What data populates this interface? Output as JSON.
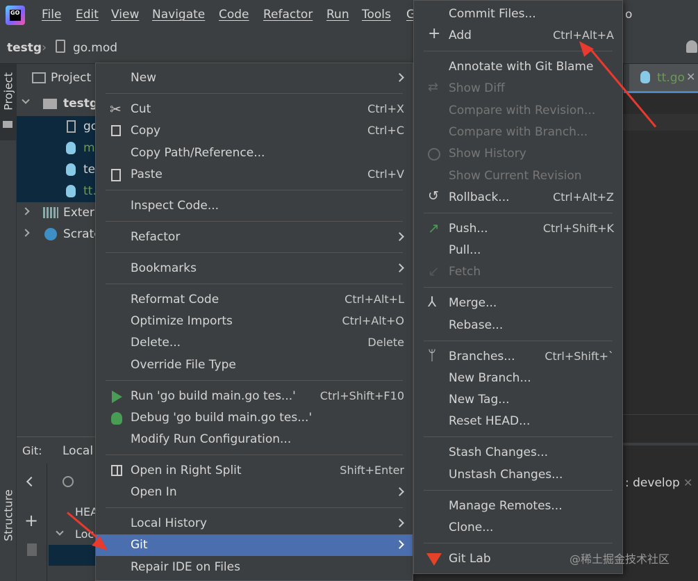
{
  "menubar": {
    "items": [
      "File",
      "Edit",
      "View",
      "Navigate",
      "Code",
      "Refactor",
      "Run",
      "Tools",
      "G"
    ],
    "logo_text": "GO",
    "trailing_text": "o"
  },
  "breadcrumb": {
    "project": "testg",
    "file": "go.mod"
  },
  "left_strip": {
    "project_tab": "Project",
    "structure_tab": "Structure"
  },
  "project_panel": {
    "header": "Project",
    "root": "testg",
    "files": [
      "go",
      "m",
      "te",
      "tt."
    ],
    "external": "Extern",
    "scratches": "Scratc"
  },
  "git_panel": {
    "label": "Git:",
    "local_tab": "Local",
    "head": "HEA",
    "local": "Loc"
  },
  "editor": {
    "tab": "tt.go",
    "branch_text": ": develop"
  },
  "context_menu": {
    "items": [
      {
        "label": "New",
        "shortcut": "",
        "submenu": true
      },
      {
        "label": "Cut",
        "shortcut": "Ctrl+X"
      },
      {
        "label": "Copy",
        "shortcut": "Ctrl+C"
      },
      {
        "label": "Copy Path/Reference...",
        "shortcut": ""
      },
      {
        "label": "Paste",
        "shortcut": "Ctrl+V"
      },
      {
        "label": "Inspect Code...",
        "shortcut": ""
      },
      {
        "label": "Refactor",
        "shortcut": "",
        "submenu": true
      },
      {
        "label": "Bookmarks",
        "shortcut": "",
        "submenu": true
      },
      {
        "label": "Reformat Code",
        "shortcut": "Ctrl+Alt+L"
      },
      {
        "label": "Optimize Imports",
        "shortcut": "Ctrl+Alt+O"
      },
      {
        "label": "Delete...",
        "shortcut": "Delete"
      },
      {
        "label": "Override File Type",
        "shortcut": ""
      },
      {
        "label": "Run 'go build main.go tes...'",
        "shortcut": "Ctrl+Shift+F10"
      },
      {
        "label": "Debug 'go build main.go tes...'",
        "shortcut": ""
      },
      {
        "label": "Modify Run Configuration...",
        "shortcut": ""
      },
      {
        "label": "Open in Right Split",
        "shortcut": "Shift+Enter"
      },
      {
        "label": "Open In",
        "shortcut": "",
        "submenu": true
      },
      {
        "label": "Local History",
        "shortcut": "",
        "submenu": true
      },
      {
        "label": "Git",
        "shortcut": "",
        "submenu": true
      },
      {
        "label": "Repair IDE on Files",
        "shortcut": ""
      }
    ]
  },
  "git_menu": {
    "items": [
      {
        "label": "Commit Files...",
        "shortcut": ""
      },
      {
        "label": "Add",
        "shortcut": "Ctrl+Alt+A"
      },
      {
        "label": "Annotate with Git Blame",
        "shortcut": ""
      },
      {
        "label": "Show Diff",
        "shortcut": "",
        "disabled": true
      },
      {
        "label": "Compare with Revision...",
        "shortcut": "",
        "disabled": true
      },
      {
        "label": "Compare with Branch...",
        "shortcut": "",
        "disabled": true
      },
      {
        "label": "Show History",
        "shortcut": "",
        "disabled": true
      },
      {
        "label": "Show Current Revision",
        "shortcut": "",
        "disabled": true
      },
      {
        "label": "Rollback...",
        "shortcut": "Ctrl+Alt+Z"
      },
      {
        "label": "Push...",
        "shortcut": "Ctrl+Shift+K"
      },
      {
        "label": "Pull...",
        "shortcut": ""
      },
      {
        "label": "Fetch",
        "shortcut": "",
        "disabled": true
      },
      {
        "label": "Merge...",
        "shortcut": ""
      },
      {
        "label": "Rebase...",
        "shortcut": ""
      },
      {
        "label": "Branches...",
        "shortcut": "Ctrl+Shift+`"
      },
      {
        "label": "New Branch...",
        "shortcut": ""
      },
      {
        "label": "New Tag...",
        "shortcut": ""
      },
      {
        "label": "Reset HEAD...",
        "shortcut": ""
      },
      {
        "label": "Stash Changes...",
        "shortcut": ""
      },
      {
        "label": "Unstash Changes...",
        "shortcut": ""
      },
      {
        "label": "Manage Remotes...",
        "shortcut": ""
      },
      {
        "label": "Clone...",
        "shortcut": ""
      },
      {
        "label": "Git Lab",
        "shortcut": ""
      }
    ]
  },
  "watermark": "@稀土掘金技术社区",
  "colors": {
    "highlight": "#4b6eaf",
    "arrow": "#e83a2e",
    "background": "#3c3f41"
  }
}
